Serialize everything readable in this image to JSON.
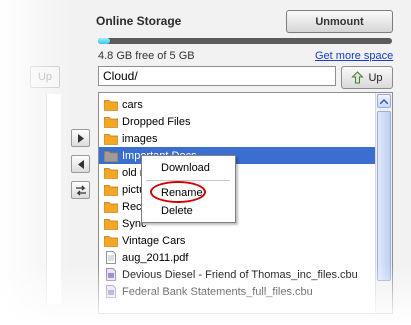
{
  "panel": {
    "title": "Online Storage",
    "unmount_label": "Unmount",
    "storage_used_fraction": 0.04,
    "storage_info": "4.8 GB free of 5 GB",
    "more_space_link": "Get more space",
    "path_value": "Cloud/",
    "up_label": "Up"
  },
  "left_panel": {
    "up_label": "Up"
  },
  "files": [
    {
      "name": "cars",
      "kind": "folder"
    },
    {
      "name": "Dropped Files",
      "kind": "folder"
    },
    {
      "name": "images",
      "kind": "folder"
    },
    {
      "name": "Important Docs",
      "kind": "folder-gray"
    },
    {
      "name": "old r",
      "kind": "folder"
    },
    {
      "name": "pictu",
      "kind": "folder"
    },
    {
      "name": "Recy",
      "kind": "folder"
    },
    {
      "name": "Sync",
      "kind": "folder"
    },
    {
      "name": "Vintage Cars",
      "kind": "folder"
    },
    {
      "name": "aug_2011.pdf",
      "kind": "file"
    },
    {
      "name": "Devious Diesel - Friend of Thomas_inc_files.cbu",
      "kind": "cbu"
    },
    {
      "name": "Federal Bank Statements_full_files.cbu",
      "kind": "cbu"
    }
  ],
  "context_menu": {
    "download": "Download",
    "rename": "Rename",
    "delete": "Delete"
  },
  "colors": {
    "selection": "#3a6fd0",
    "folder": "#f5a623",
    "highlight_ring": "#d10000",
    "link": "#1a3cc7"
  }
}
